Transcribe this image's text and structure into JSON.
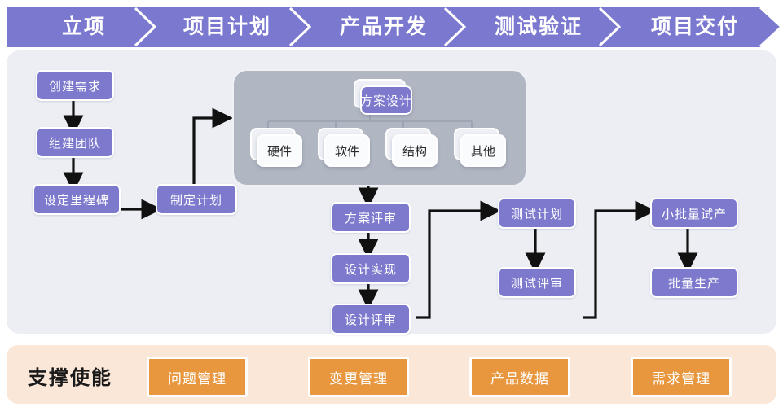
{
  "theme": {
    "phase_purple": "#7b78cf",
    "node_purple": "#7d7ace",
    "panel_bg": "#eceef4",
    "group_grey": "#b0b6c2",
    "support_bg": "#fae7d8",
    "chip_orange": "#e8973f",
    "card_light": "#fafbfd",
    "connector": "#111111"
  },
  "phases": [
    {
      "label": "立项"
    },
    {
      "label": "项目计划"
    },
    {
      "label": "产品开发"
    },
    {
      "label": "测试验证"
    },
    {
      "label": "项目交付"
    }
  ],
  "flow": {
    "requirement_nodes": [
      {
        "label": "创建需求"
      },
      {
        "label": "组建团队"
      },
      {
        "label": "设定里程碑"
      },
      {
        "label": "制定计划"
      }
    ],
    "design_group": {
      "root": {
        "label": "方案设计"
      },
      "children": [
        {
          "label": "硬件"
        },
        {
          "label": "软件"
        },
        {
          "label": "结构"
        },
        {
          "label": "其他"
        }
      ]
    },
    "develop_nodes": [
      {
        "label": "方案评审"
      },
      {
        "label": "设计实现"
      },
      {
        "label": "设计评审"
      }
    ],
    "test_nodes": [
      {
        "label": "测试计划"
      },
      {
        "label": "测试评审"
      }
    ],
    "delivery_nodes": [
      {
        "label": "小批量试产"
      },
      {
        "label": "批量生产"
      }
    ]
  },
  "support": {
    "title": "支撑使能",
    "chips": [
      {
        "label": "问题管理"
      },
      {
        "label": "变更管理"
      },
      {
        "label": "产品数据"
      },
      {
        "label": "需求管理"
      }
    ]
  }
}
